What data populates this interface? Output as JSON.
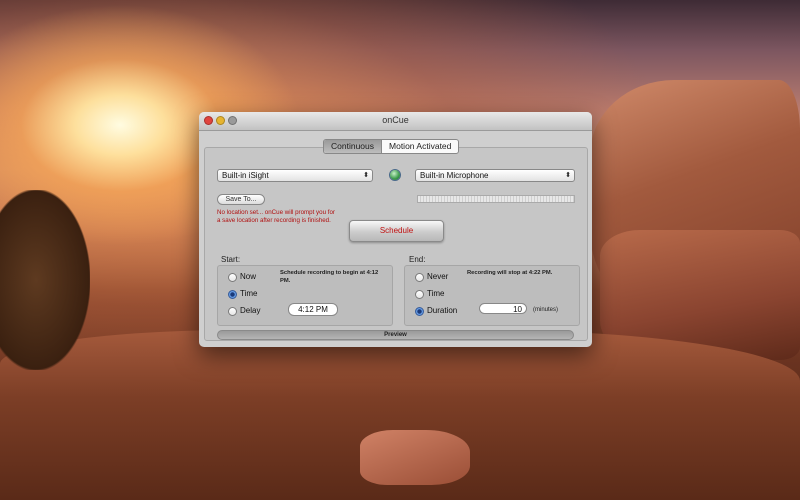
{
  "window": {
    "title": "onCue"
  },
  "tabs": [
    {
      "label": "Continuous",
      "selected": true
    },
    {
      "label": "Motion Activated",
      "selected": false
    }
  ],
  "sources": {
    "camera": "Built-in iSight",
    "microphone": "Built-in Microphone"
  },
  "save": {
    "button_label": "Save To...",
    "warning": "No location set... onCue will prompt you for a save location after recording is finished."
  },
  "schedule_button": "Schedule",
  "start": {
    "label": "Start:",
    "options": [
      "Now",
      "Time",
      "Delay"
    ],
    "selected": "Time",
    "note": "Schedule recording to begin at 4:12 PM.",
    "time_value": "4:12 PM"
  },
  "end": {
    "label": "End:",
    "options": [
      "Never",
      "Time",
      "Duration"
    ],
    "selected": "Duration",
    "note": "Recording will stop at 4:22 PM.",
    "duration_value": "10",
    "duration_units": "(minutes)"
  },
  "preview_button": "Preview",
  "colors": {
    "warning_text": "#b01010",
    "schedule_text": "#c01010",
    "radio_selected": "#3a76cc"
  }
}
